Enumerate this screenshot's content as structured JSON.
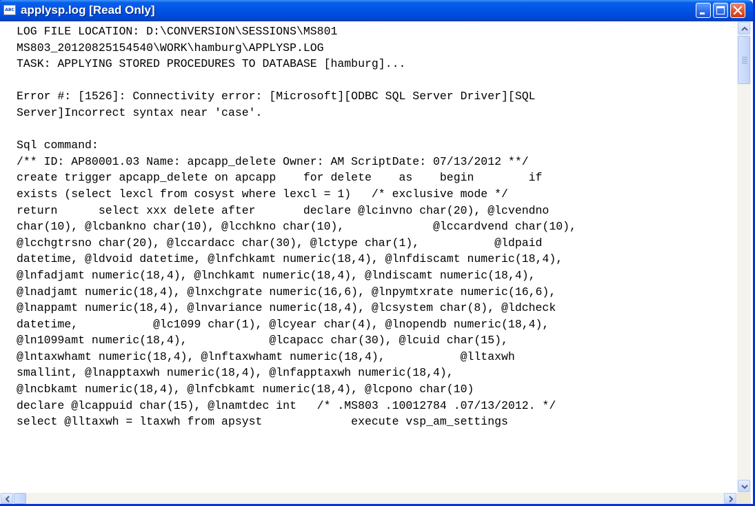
{
  "window": {
    "title": "applysp.log [Read Only]",
    "icon": "notepad-icon",
    "icon_label": "ABC"
  },
  "log_lines": [
    "LOG FILE LOCATION: D:\\CONVERSION\\SESSIONS\\MS801",
    "MS803_20120825154540\\WORK\\hamburg\\APPLYSP.LOG",
    "TASK: APPLYING STORED PROCEDURES TO DATABASE [hamburg]...",
    "",
    "Error #: [1526]: Connectivity error: [Microsoft][ODBC SQL Server Driver][SQL",
    "Server]Incorrect syntax near 'case'.",
    "",
    "Sql command:",
    "/** ID: AP80001.03 Name: apcapp_delete Owner: AM ScriptDate: 07/13/2012 **/",
    "create trigger apcapp_delete on apcapp    for delete    as    begin        if",
    "exists (select lexcl from cosyst where lexcl = 1)   /* exclusive mode */",
    "return      select xxx delete after       declare @lcinvno char(20), @lcvendno",
    "char(10), @lcbankno char(10), @lcchkno char(10),             @lccardvend char(10),",
    "@lcchgtrsno char(20), @lccardacc char(30), @lctype char(1),           @ldpaid",
    "datetime, @ldvoid datetime, @lnfchkamt numeric(18,4), @lnfdiscamt numeric(18,4),",
    "@lnfadjamt numeric(18,4), @lnchkamt numeric(18,4), @lndiscamt numeric(18,4),",
    "@lnadjamt numeric(18,4), @lnxchgrate numeric(16,6), @lnpymtxrate numeric(16,6),",
    "@lnappamt numeric(18,4), @lnvariance numeric(18,4), @lcsystem char(8), @ldcheck",
    "datetime,           @lc1099 char(1), @lcyear char(4), @lnopendb numeric(18,4),",
    "@ln1099amt numeric(18,4),            @lcapacc char(30), @lcuid char(15),",
    "@lntaxwhamt numeric(18,4), @lnftaxwhamt numeric(18,4),           @lltaxwh",
    "smallint, @lnapptaxwh numeric(18,4), @lnfapptaxwh numeric(18,4),",
    "@lncbkamt numeric(18,4), @lnfcbkamt numeric(18,4), @lcpono char(10)",
    "declare @lcappuid char(15), @lnamtdec int   /* .MS803 .10012784 .07/13/2012. */",
    "select @lltaxwh = ltaxwh from apsyst             execute vsp_am_settings"
  ],
  "scrollbars": {
    "vertical_position": 0.0,
    "horizontal_position": 0.0
  },
  "colors": {
    "titlebar": "#0054e3",
    "window_border": "#0831d9",
    "close_button": "#e0502a"
  }
}
